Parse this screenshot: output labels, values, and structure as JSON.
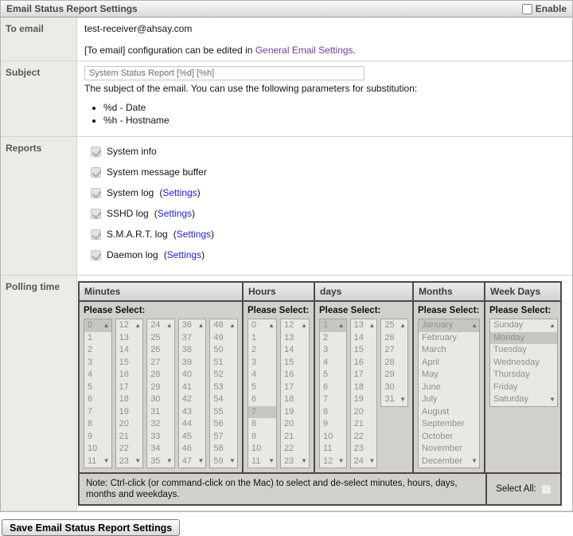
{
  "title": "Email Status Report Settings",
  "enable_label": "Enable",
  "rows": {
    "to_email": {
      "label": "To email",
      "value": "test-receiver@ahsay.com",
      "note_prefix": "[To email] configuration can be edited in ",
      "note_link": "General Email Settings",
      "note_suffix": "."
    },
    "subject": {
      "label": "Subject",
      "value": "System Status Report [%d] [%h]",
      "description": "The subject of the email. You can use the following parameters for substitution:",
      "params": [
        "%d - Date",
        "%h - Hostname"
      ]
    },
    "reports": {
      "label": "Reports",
      "settings_link": "Settings",
      "items": [
        {
          "label": "System info",
          "checked": true,
          "has_settings": false
        },
        {
          "label": "System message buffer",
          "checked": true,
          "has_settings": false
        },
        {
          "label": "System log",
          "checked": true,
          "has_settings": true
        },
        {
          "label": "SSHD log",
          "checked": true,
          "has_settings": true
        },
        {
          "label": "S.M.A.R.T. log",
          "checked": true,
          "has_settings": true
        },
        {
          "label": "Daemon log",
          "checked": true,
          "has_settings": true
        }
      ]
    },
    "polling": {
      "label": "Polling time",
      "please_select": "Please Select:",
      "columns": [
        {
          "header": "Minutes",
          "boxes": [
            [
              "0",
              "1",
              "2",
              "3",
              "4",
              "5",
              "6",
              "7",
              "8",
              "9",
              "10",
              "11"
            ],
            [
              "12",
              "13",
              "14",
              "15",
              "16",
              "17",
              "18",
              "19",
              "20",
              "21",
              "22",
              "23"
            ],
            [
              "24",
              "25",
              "26",
              "27",
              "28",
              "29",
              "30",
              "31",
              "32",
              "33",
              "34",
              "35"
            ],
            [
              "36",
              "37",
              "38",
              "39",
              "40",
              "41",
              "42",
              "43",
              "44",
              "45",
              "46",
              "47"
            ],
            [
              "48",
              "49",
              "50",
              "51",
              "52",
              "53",
              "54",
              "55",
              "56",
              "57",
              "58",
              "59"
            ]
          ],
          "selected": [
            "0"
          ]
        },
        {
          "header": "Hours",
          "boxes": [
            [
              "0",
              "1",
              "2",
              "3",
              "4",
              "5",
              "6",
              "7",
              "8",
              "9",
              "10",
              "11"
            ],
            [
              "12",
              "13",
              "14",
              "15",
              "16",
              "17",
              "18",
              "19",
              "20",
              "21",
              "22",
              "23"
            ]
          ],
          "selected": [
            "7"
          ]
        },
        {
          "header": "days",
          "boxes": [
            [
              "1",
              "2",
              "3",
              "4",
              "5",
              "6",
              "7",
              "8",
              "9",
              "10",
              "11",
              "12"
            ],
            [
              "13",
              "14",
              "15",
              "16",
              "17",
              "18",
              "19",
              "20",
              "21",
              "22",
              "23",
              "24"
            ],
            [
              "25",
              "26",
              "27",
              "28",
              "29",
              "30",
              "31"
            ]
          ],
          "selected": [
            "1"
          ]
        },
        {
          "header": "Months",
          "boxes": [
            [
              "January",
              "February",
              "March",
              "April",
              "May",
              "June",
              "July",
              "August",
              "September",
              "October",
              "November",
              "December"
            ]
          ],
          "selected": [
            "January"
          ]
        },
        {
          "header": "Week Days",
          "boxes": [
            [
              "Sunday",
              "Monday",
              "Tuesday",
              "Wednesday",
              "Thursday",
              "Friday",
              "Saturday"
            ]
          ],
          "selected": [
            "Monday"
          ]
        }
      ],
      "note": "Note: Ctrl-click (or command-click on the Mac) to select and de-select minutes, hours, days, months and weekdays.",
      "select_all_label": "Select All:"
    }
  },
  "save_button": "Save Email Status Report Settings",
  "colors": {
    "link_purple": "#7d3a97",
    "link_blue": "#2222cc",
    "panel_silver": "#d2d0cb",
    "label_bg": "#edebe6"
  }
}
